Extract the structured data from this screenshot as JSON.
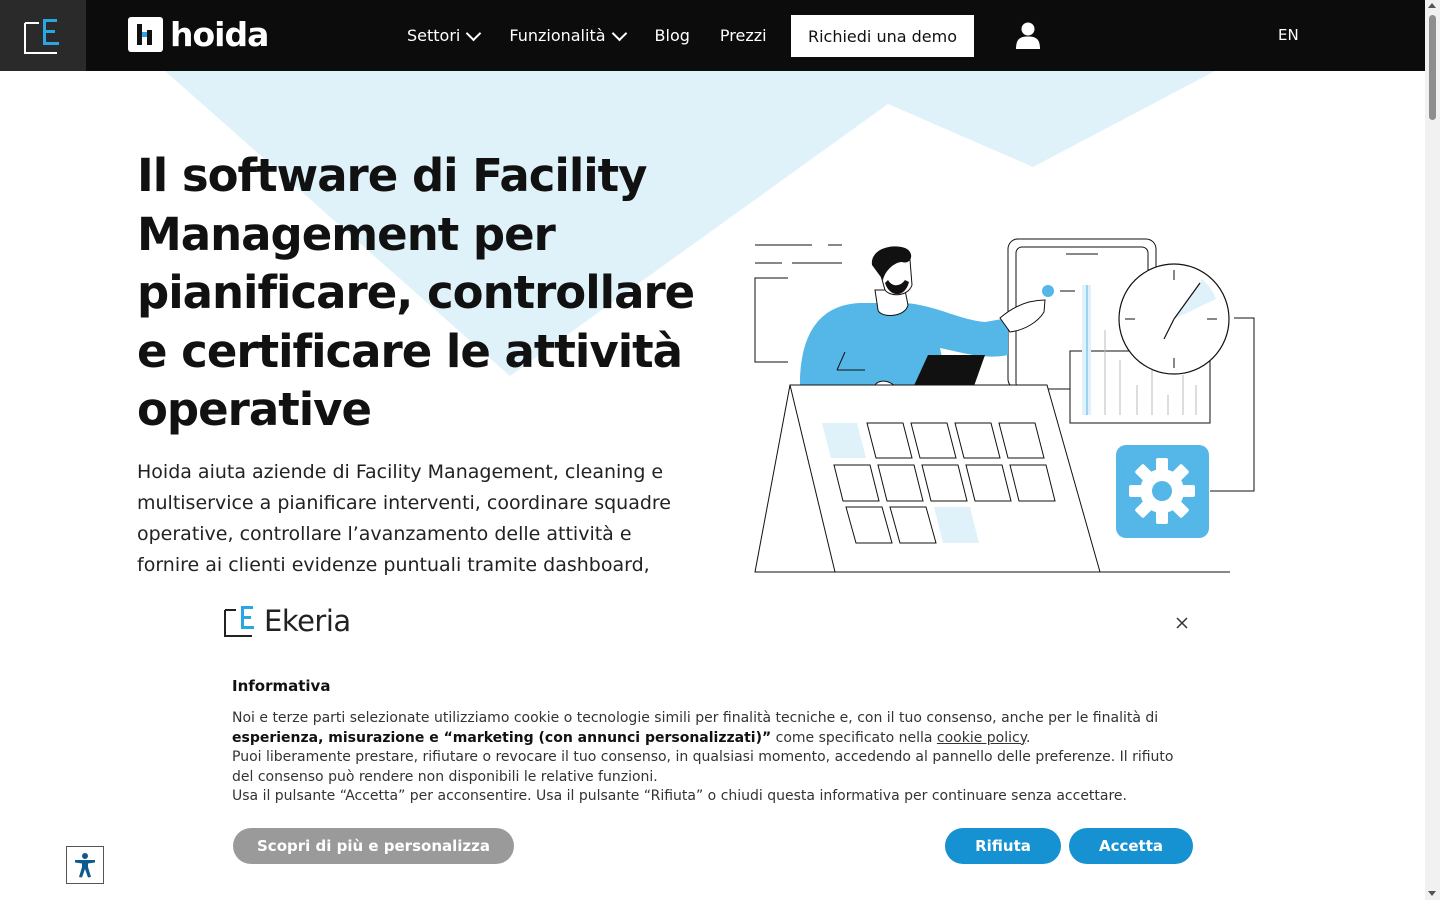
{
  "nav": {
    "brand": "hoida",
    "menu": [
      {
        "label": "Settori",
        "has_dropdown": true
      },
      {
        "label": "Funzionalità",
        "has_dropdown": true
      },
      {
        "label": "Blog",
        "has_dropdown": false
      },
      {
        "label": "Prezzi",
        "has_dropdown": false
      }
    ],
    "demo_button": "Richiedi una demo",
    "lang": "EN"
  },
  "hero": {
    "title": "Il software di Facility Management per pianificare, controllare e certificare le attività operative",
    "description": "Hoida aiuta aziende di Facility Management, cleaning e multiservice a pianificare interventi, coordinare squadre operative, controllare l’avanzamento delle attività e fornire ai clienti evidenze puntuali tramite dashboard,"
  },
  "cookie": {
    "brand": "Ekeria",
    "title": "Informativa",
    "p1_a": "Noi e terze parti selezionate utilizziamo cookie o tecnologie simili per finalità tecniche e, con il tuo consenso, anche per le finalità di ",
    "p1_bold": "esperienza, misurazione e “marketing (con annunci personalizzati)”",
    "p1_b": " come specificato nella ",
    "p1_link": "cookie policy",
    "p1_c": ".",
    "p2": "Puoi liberamente prestare, rifiutare o revocare il tuo consenso, in qualsiasi momento, accedendo al pannello delle preferenze. Il rifiuto del consenso può rendere non disponibili le relative funzioni.",
    "p3": "Usa il pulsante “Accetta” per acconsentire. Usa il pulsante “Rifiuta” o chiudi questa informativa per continuare senza accettare.",
    "btn_more": "Scopri di più e personalizza",
    "btn_reject": "Rifiuta",
    "btn_accept": "Accetta"
  },
  "colors": {
    "accent": "#1691d2",
    "light_blue": "#dff2fa",
    "illus_blue": "#55b7e8",
    "nav_bg": "#0c0c0c"
  }
}
